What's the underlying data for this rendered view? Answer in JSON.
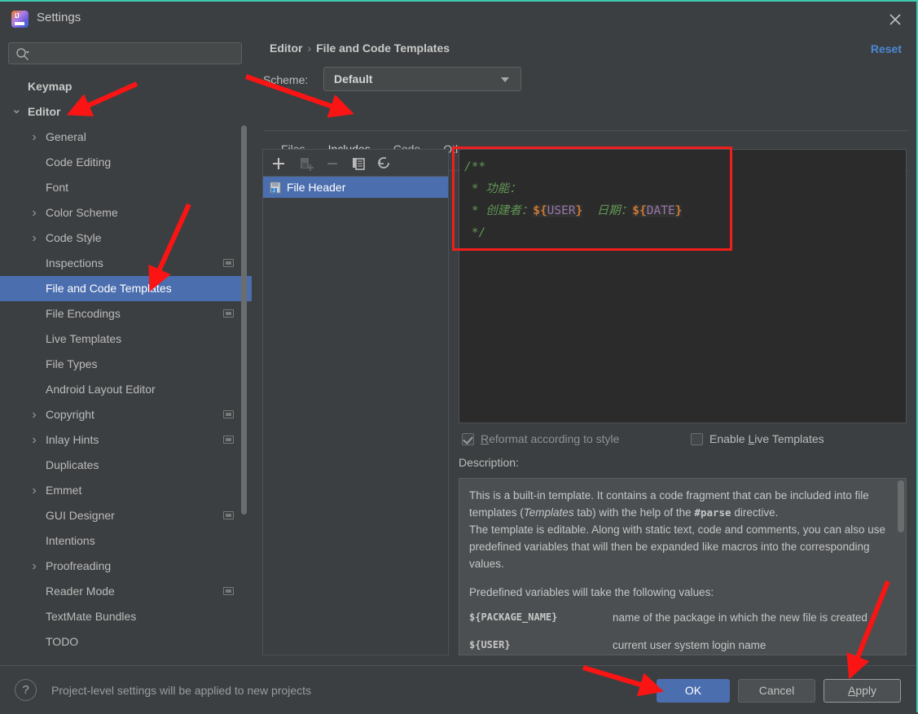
{
  "window": {
    "title": "Settings",
    "logo_icon": "intellij-idea-logo",
    "close_icon": "close-icon",
    "accent_border_color": "#3ec9b0"
  },
  "search": {
    "placeholder": "",
    "value": "",
    "icon": "search-icon"
  },
  "sidebar": {
    "items": [
      {
        "label": "Keymap",
        "depth": 0,
        "arrow": "",
        "bold": true,
        "selected": false,
        "config_icon": false
      },
      {
        "label": "Editor",
        "depth": 0,
        "arrow": "v",
        "bold": true,
        "selected": false,
        "config_icon": false
      },
      {
        "label": "General",
        "depth": 1,
        "arrow": ">",
        "bold": false,
        "selected": false,
        "config_icon": false
      },
      {
        "label": "Code Editing",
        "depth": 1,
        "arrow": "",
        "bold": false,
        "selected": false,
        "config_icon": false
      },
      {
        "label": "Font",
        "depth": 1,
        "arrow": "",
        "bold": false,
        "selected": false,
        "config_icon": false
      },
      {
        "label": "Color Scheme",
        "depth": 1,
        "arrow": ">",
        "bold": false,
        "selected": false,
        "config_icon": false
      },
      {
        "label": "Code Style",
        "depth": 1,
        "arrow": ">",
        "bold": false,
        "selected": false,
        "config_icon": false
      },
      {
        "label": "Inspections",
        "depth": 1,
        "arrow": "",
        "bold": false,
        "selected": false,
        "config_icon": true
      },
      {
        "label": "File and Code Templates",
        "depth": 1,
        "arrow": "",
        "bold": false,
        "selected": true,
        "config_icon": false
      },
      {
        "label": "File Encodings",
        "depth": 1,
        "arrow": "",
        "bold": false,
        "selected": false,
        "config_icon": true
      },
      {
        "label": "Live Templates",
        "depth": 1,
        "arrow": "",
        "bold": false,
        "selected": false,
        "config_icon": false
      },
      {
        "label": "File Types",
        "depth": 1,
        "arrow": "",
        "bold": false,
        "selected": false,
        "config_icon": false
      },
      {
        "label": "Android Layout Editor",
        "depth": 1,
        "arrow": "",
        "bold": false,
        "selected": false,
        "config_icon": false
      },
      {
        "label": "Copyright",
        "depth": 1,
        "arrow": ">",
        "bold": false,
        "selected": false,
        "config_icon": true
      },
      {
        "label": "Inlay Hints",
        "depth": 1,
        "arrow": ">",
        "bold": false,
        "selected": false,
        "config_icon": true
      },
      {
        "label": "Duplicates",
        "depth": 1,
        "arrow": "",
        "bold": false,
        "selected": false,
        "config_icon": false
      },
      {
        "label": "Emmet",
        "depth": 1,
        "arrow": ">",
        "bold": false,
        "selected": false,
        "config_icon": false
      },
      {
        "label": "GUI Designer",
        "depth": 1,
        "arrow": "",
        "bold": false,
        "selected": false,
        "config_icon": true
      },
      {
        "label": "Intentions",
        "depth": 1,
        "arrow": "",
        "bold": false,
        "selected": false,
        "config_icon": false
      },
      {
        "label": "Proofreading",
        "depth": 1,
        "arrow": ">",
        "bold": false,
        "selected": false,
        "config_icon": false
      },
      {
        "label": "Reader Mode",
        "depth": 1,
        "arrow": "",
        "bold": false,
        "selected": false,
        "config_icon": true
      },
      {
        "label": "TextMate Bundles",
        "depth": 1,
        "arrow": "",
        "bold": false,
        "selected": false,
        "config_icon": false
      },
      {
        "label": "TODO",
        "depth": 1,
        "arrow": "",
        "bold": false,
        "selected": false,
        "config_icon": false
      }
    ]
  },
  "header": {
    "breadcrumb_parent": "Editor",
    "breadcrumb_separator": "›",
    "breadcrumb_current": "File and Code Templates",
    "reset_label": "Reset",
    "reset_color": "#4a88d6",
    "scheme_label": "Scheme:",
    "scheme_value": "Default",
    "scheme_caret_icon": "chevron-down-icon"
  },
  "tabs": [
    {
      "label": "Files",
      "active": false
    },
    {
      "label": "Includes",
      "active": true
    },
    {
      "label": "Code",
      "active": false
    },
    {
      "label": "Other",
      "active": false
    }
  ],
  "list_toolbar": [
    {
      "name": "add-button",
      "icon": "plus-icon",
      "enabled": true
    },
    {
      "name": "add-child-button",
      "icon": "add-file-icon",
      "enabled": false
    },
    {
      "name": "remove-button",
      "icon": "minus-icon",
      "enabled": false
    },
    {
      "name": "copy-button",
      "icon": "copy-icon",
      "enabled": true
    },
    {
      "name": "reset-button",
      "icon": "revert-arrow-icon",
      "enabled": true
    }
  ],
  "template_list": {
    "items": [
      {
        "label": "File Header",
        "icon": "java-template-file-icon",
        "selected": true
      }
    ]
  },
  "editor": {
    "lines": [
      {
        "segments": [
          {
            "text": "/**",
            "type": "comment"
          }
        ]
      },
      {
        "segments": [
          {
            "text": " * 功能：",
            "type": "comment"
          }
        ]
      },
      {
        "segments": [
          {
            "text": " * 创建者：",
            "type": "comment"
          },
          {
            "text": "${USER}",
            "type": "variable"
          },
          {
            "text": "  日期：",
            "type": "comment"
          },
          {
            "text": "${DATE}",
            "type": "variable"
          }
        ]
      },
      {
        "segments": [
          {
            "text": " */",
            "type": "comment"
          }
        ]
      }
    ],
    "comment_color": "#629755",
    "variable_color": "#9876aa",
    "dollar_color": "#cc7832",
    "background": "#2b2b2b",
    "highlight_box_color": "#f21d1d"
  },
  "options": {
    "reformat": {
      "label": "Reformat according to style",
      "mnemonic": "R",
      "checked": true,
      "enabled": false
    },
    "live_templates": {
      "label": "Enable Live Templates",
      "mnemonic": "L",
      "checked": false,
      "enabled": true
    }
  },
  "description": {
    "label": "Description:",
    "paragraph1_a": "This is a built-in template. It contains a code fragment that can be included into file templates (",
    "paragraph1_italic": "Templates",
    "paragraph1_b": " tab) with the help of the ",
    "paragraph1_code": "#parse",
    "paragraph1_c": " directive.",
    "paragraph2": "The template is editable. Along with static text, code and comments, you can also use predefined variables that will then be expanded like macros into the corresponding values.",
    "variables_intro": "Predefined variables will take the following values:",
    "variables": [
      {
        "name": "${PACKAGE_NAME}",
        "desc": "name of the package in which the new file is created"
      },
      {
        "name": "${USER}",
        "desc": "current user system login name"
      }
    ]
  },
  "footer": {
    "help_icon": "question-mark-icon",
    "note": "Project-level settings will be applied to new projects",
    "ok_label": "OK",
    "cancel_label": "Cancel",
    "apply_label": "Apply",
    "ok_color": "#4b6eaf"
  },
  "annotations": {
    "arrow_color": "#fb1414",
    "arrows": [
      {
        "name": "arrow-to-editor-tree-item",
        "target": "Editor"
      },
      {
        "name": "arrow-to-file-and-code-templates",
        "target": "File and Code Templates"
      },
      {
        "name": "arrow-to-includes-tab",
        "target": "Includes"
      },
      {
        "name": "arrow-to-ok-button",
        "target": "OK"
      },
      {
        "name": "arrow-to-apply-button",
        "target": "Apply"
      }
    ]
  }
}
